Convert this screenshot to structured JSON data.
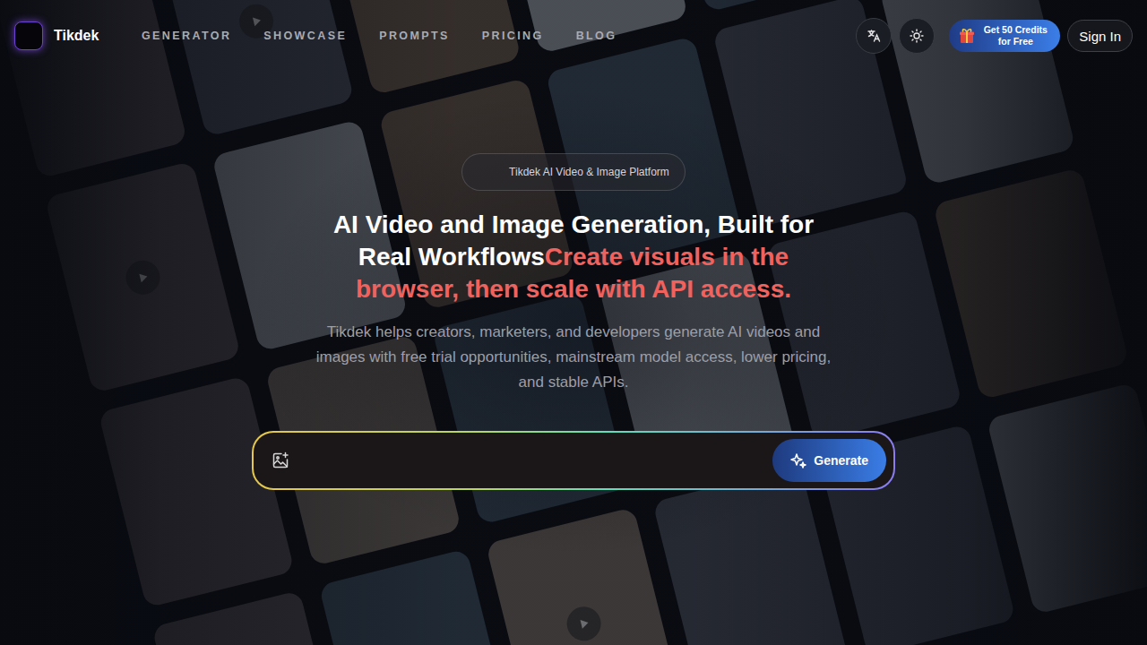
{
  "brand": {
    "name": "Tikdek"
  },
  "nav": [
    {
      "label": "GENERATOR"
    },
    {
      "label": "SHOWCASE"
    },
    {
      "label": "PROMPTS"
    },
    {
      "label": "PRICING"
    },
    {
      "label": "BLOG"
    }
  ],
  "header_actions": {
    "credits_button": "Get 50 Credits for Free",
    "sign_in": "Sign In"
  },
  "hero": {
    "badge": "Tikdek AI Video & Image Platform",
    "title": "AI Video and Image Generation, Built for Real Workflows",
    "highlight": "Create visuals in the browser, then scale with API access.",
    "subtitle": "Tikdek helps creators, marketers, and developers generate AI videos and images with free trial opportunities, mainstream model access, lower pricing, and stable APIs."
  },
  "prompt": {
    "placeholder": "",
    "button": "Generate"
  },
  "gallery": [
    {
      "kind": "image"
    },
    {
      "kind": "video"
    },
    {
      "kind": "image"
    },
    {
      "kind": "image"
    },
    {
      "kind": "image"
    },
    {
      "kind": "image"
    },
    {
      "kind": "video"
    },
    {
      "kind": "image"
    },
    {
      "kind": "image"
    },
    {
      "kind": "image"
    },
    {
      "kind": "image"
    },
    {
      "kind": "image"
    },
    {
      "kind": "image"
    },
    {
      "kind": "video"
    },
    {
      "kind": "image"
    },
    {
      "kind": "image"
    },
    {
      "kind": "image"
    },
    {
      "kind": "image"
    },
    {
      "kind": "image"
    },
    {
      "kind": "image"
    },
    {
      "kind": "video"
    },
    {
      "kind": "image"
    },
    {
      "kind": "image"
    },
    {
      "kind": "image"
    }
  ]
}
